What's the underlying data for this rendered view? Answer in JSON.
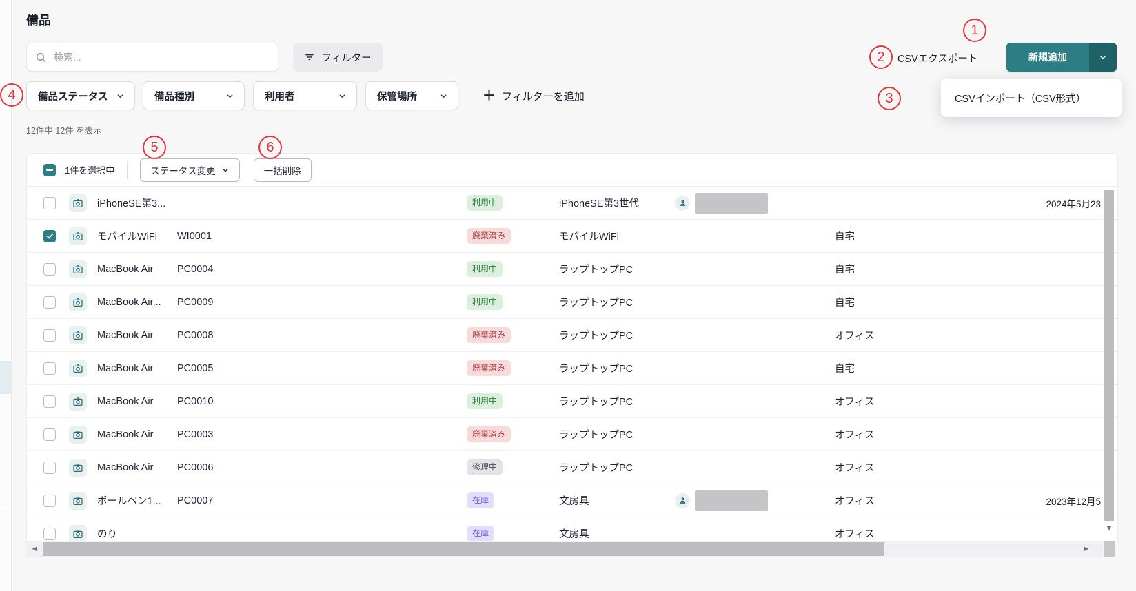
{
  "page": {
    "title": "備品"
  },
  "toolbar": {
    "search_placeholder": "検索...",
    "filter_button": "フィルター",
    "csv_export": "CSVエクスポート",
    "add_new": "新規追加",
    "csv_import": "CSVインポート（CSV形式）",
    "add_filter": "フィルターを追加"
  },
  "filters": {
    "chips": [
      {
        "label": "備品ステータス"
      },
      {
        "label": "備品種別"
      },
      {
        "label": "利用者"
      },
      {
        "label": "保管場所"
      }
    ]
  },
  "result_count": "12件中 12件 を表示",
  "selection_bar": {
    "selected_text": "1件を選択中",
    "status_change": "ステータス変更",
    "bulk_delete": "一括削除"
  },
  "annotations": [
    "1",
    "2",
    "3",
    "4",
    "5",
    "6"
  ],
  "table": {
    "rows": [
      {
        "name": "iPhoneSE第3...",
        "code": "",
        "status": "利用中",
        "status_type": "in_use",
        "type": "iPhoneSE第3世代",
        "has_user": true,
        "location": "",
        "date": "2024年5月23",
        "checked": false
      },
      {
        "name": "モバイルWiFi",
        "code": "WI0001",
        "status": "廃棄済み",
        "status_type": "disposed",
        "type": "モバイルWiFi",
        "has_user": false,
        "location": "自宅",
        "date": "",
        "checked": true
      },
      {
        "name": "MacBook Air",
        "code": "PC0004",
        "status": "利用中",
        "status_type": "in_use",
        "type": "ラップトップPC",
        "has_user": false,
        "location": "自宅",
        "date": "",
        "checked": false
      },
      {
        "name": "MacBook Air...",
        "code": "PC0009",
        "status": "利用中",
        "status_type": "in_use",
        "type": "ラップトップPC",
        "has_user": false,
        "location": "自宅",
        "date": "",
        "checked": false
      },
      {
        "name": "MacBook Air",
        "code": "PC0008",
        "status": "廃棄済み",
        "status_type": "disposed",
        "type": "ラップトップPC",
        "has_user": false,
        "location": "オフィス",
        "date": "",
        "checked": false
      },
      {
        "name": "MacBook Air",
        "code": "PC0005",
        "status": "廃棄済み",
        "status_type": "disposed",
        "type": "ラップトップPC",
        "has_user": false,
        "location": "自宅",
        "date": "",
        "checked": false
      },
      {
        "name": "MacBook Air",
        "code": "PC0010",
        "status": "利用中",
        "status_type": "in_use",
        "type": "ラップトップPC",
        "has_user": false,
        "location": "オフィス",
        "date": "",
        "checked": false
      },
      {
        "name": "MacBook Air",
        "code": "PC0003",
        "status": "廃棄済み",
        "status_type": "disposed",
        "type": "ラップトップPC",
        "has_user": false,
        "location": "オフィス",
        "date": "",
        "checked": false
      },
      {
        "name": "MacBook Air",
        "code": "PC0006",
        "status": "修理中",
        "status_type": "repair",
        "type": "ラップトップPC",
        "has_user": false,
        "location": "オフィス",
        "date": "",
        "checked": false
      },
      {
        "name": "ボールペン1...",
        "code": "PC0007",
        "status": "在庫",
        "status_type": "stock",
        "type": "文房具",
        "has_user": true,
        "location": "オフィス",
        "date": "2023年12月5",
        "checked": false
      },
      {
        "name": "のり",
        "code": "",
        "status": "在庫",
        "status_type": "stock",
        "type": "文房具",
        "has_user": false,
        "location": "オフィス",
        "date": "",
        "checked": false
      }
    ]
  },
  "colors": {
    "accent_teal": "#2c7d84",
    "accent_teal_dark": "#1e6167",
    "annotation_red": "#e5383d",
    "status_in_use_text": "#2e7d42",
    "status_disposed_text": "#b4494d",
    "status_repair_text": "#50505e",
    "status_stock_text": "#6a5ae0"
  }
}
